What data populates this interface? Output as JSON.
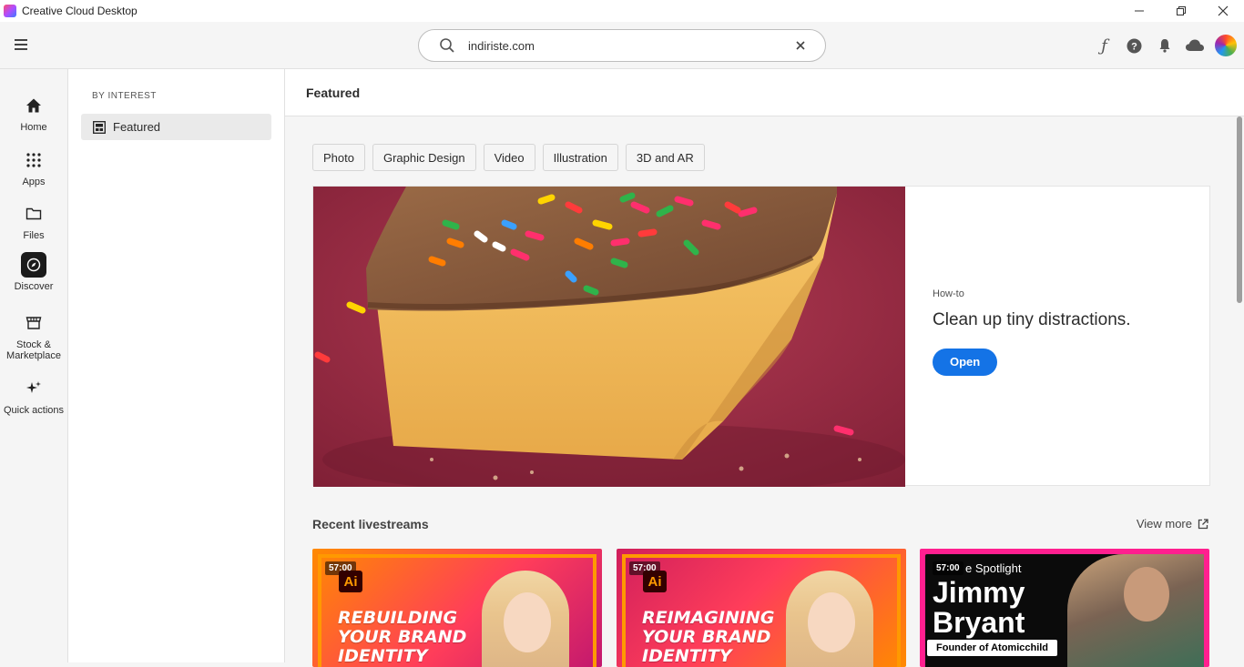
{
  "window": {
    "title": "Creative Cloud Desktop",
    "controls": {
      "minimize": "—",
      "restore": "❐",
      "close": "✕"
    }
  },
  "header": {
    "search": {
      "value": "indiriste.com",
      "clear_glyph": "✕"
    },
    "icons": [
      "fonts-icon",
      "help-icon",
      "notifications-icon",
      "cloud-icon",
      "avatar"
    ]
  },
  "rail": {
    "items": [
      {
        "label": "Home",
        "icon": "home-icon"
      },
      {
        "label": "Apps",
        "icon": "apps-grid-icon"
      },
      {
        "label": "Files",
        "icon": "folder-icon"
      },
      {
        "label": "Discover",
        "icon": "discover-icon",
        "active": true
      },
      {
        "label": "Stock &",
        "label2": "Marketplace",
        "icon": "stock-icon"
      },
      {
        "label": "Quick actions",
        "icon": "sparkle-icon"
      }
    ]
  },
  "subnav": {
    "section": "BY INTEREST",
    "items": [
      {
        "label": "Featured",
        "icon": "featured-grid-icon",
        "selected": true
      }
    ]
  },
  "main": {
    "title": "Featured",
    "chips": [
      "Photo",
      "Graphic Design",
      "Video",
      "Illustration",
      "3D and AR"
    ],
    "hero": {
      "kicker": "How-to",
      "headline": "Clean up tiny distractions.",
      "cta": "Open"
    },
    "livestreams": {
      "title": "Recent livestreams",
      "view_more": "View more",
      "cards": [
        {
          "duration": "57:00",
          "app": "Ai",
          "line1": "REBUILDING",
          "line2": "YOUR BRAND",
          "line3": "IDENTITY"
        },
        {
          "duration": "57:00",
          "app": "Ai",
          "line1": "REIMAGINING",
          "line2": "YOUR BRAND",
          "line3": "IDENTITY"
        },
        {
          "duration": "57:00",
          "spotlight": "e Spotlight",
          "name1": "Jimmy",
          "name2": "Bryant",
          "footer": "Founder of Atomicchild"
        }
      ]
    }
  },
  "colors": {
    "accent": "#1473e6",
    "rail_bg": "#f5f5f5",
    "card3_frame": "#ff1f8f"
  }
}
